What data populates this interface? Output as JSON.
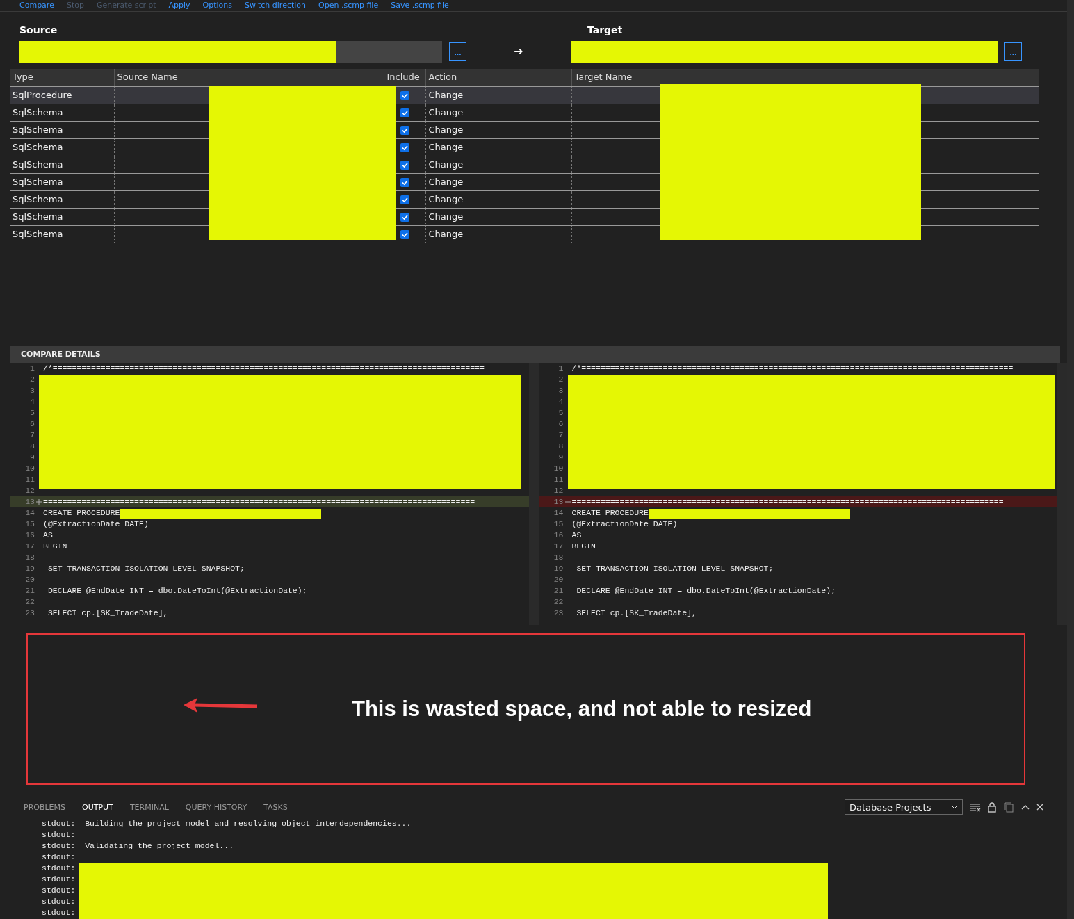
{
  "toolbar": [
    {
      "label": "Compare",
      "disabled": false
    },
    {
      "label": "Stop",
      "disabled": true
    },
    {
      "label": "Generate script",
      "disabled": true
    },
    {
      "label": "Apply",
      "disabled": false
    },
    {
      "label": "Options",
      "disabled": false
    },
    {
      "label": "Switch direction",
      "disabled": false
    },
    {
      "label": "Open .scmp file",
      "disabled": false
    },
    {
      "label": "Save .scmp file",
      "disabled": false
    }
  ],
  "source": {
    "title": "Source",
    "browse": "..."
  },
  "direction_arrow": "➔",
  "target": {
    "title": "Target",
    "browse": "..."
  },
  "table": {
    "columns": [
      "Type",
      "Source Name",
      "Include",
      "Action",
      "Target Name"
    ],
    "rows": [
      {
        "type": "SqlProcedure",
        "include": true,
        "action": "Change",
        "selected": true
      },
      {
        "type": "SqlSchema",
        "include": true,
        "action": "Change",
        "selected": false
      },
      {
        "type": "SqlSchema",
        "include": true,
        "action": "Change",
        "selected": false
      },
      {
        "type": "SqlSchema",
        "include": true,
        "action": "Change",
        "selected": false
      },
      {
        "type": "SqlSchema",
        "include": true,
        "action": "Change",
        "selected": false
      },
      {
        "type": "SqlSchema",
        "include": true,
        "action": "Change",
        "selected": false
      },
      {
        "type": "SqlSchema",
        "include": true,
        "action": "Change",
        "selected": false
      },
      {
        "type": "SqlSchema",
        "include": true,
        "action": "Change",
        "selected": false
      },
      {
        "type": "SqlSchema",
        "include": true,
        "action": "Change",
        "selected": false
      }
    ]
  },
  "compare_details": {
    "title": "COMPARE DETAILS",
    "panes": [
      {
        "lines": [
          {
            "number": "1",
            "kind": "normal",
            "text": "/*=========================================================================================="
          },
          {
            "number": "2",
            "kind": "normal"
          },
          {
            "number": "3",
            "kind": "normal"
          },
          {
            "number": "4",
            "kind": "normal"
          },
          {
            "number": "5",
            "kind": "normal"
          },
          {
            "number": "6",
            "kind": "normal"
          },
          {
            "number": "7",
            "kind": "normal"
          },
          {
            "number": "8",
            "kind": "normal"
          },
          {
            "number": "9",
            "kind": "normal"
          },
          {
            "number": "10",
            "kind": "normal"
          },
          {
            "number": "11",
            "kind": "normal"
          },
          {
            "number": "12",
            "kind": "normal"
          },
          {
            "number": "13",
            "kind": "added",
            "text": "=========================================================================================="
          },
          {
            "number": "14",
            "kind": "normal",
            "text": "CREATE PROCEDURE"
          },
          {
            "number": "15",
            "kind": "normal",
            "text": "(@ExtractionDate DATE)"
          },
          {
            "number": "16",
            "kind": "normal",
            "text": "AS"
          },
          {
            "number": "17",
            "kind": "normal",
            "text": "BEGIN"
          },
          {
            "number": "18",
            "kind": "normal"
          },
          {
            "number": "19",
            "kind": "normal",
            "text": " SET TRANSACTION ISOLATION LEVEL SNAPSHOT;"
          },
          {
            "number": "20",
            "kind": "normal"
          },
          {
            "number": "21",
            "kind": "normal",
            "text": " DECLARE @EndDate INT = dbo.DateToInt(@ExtractionDate);"
          },
          {
            "number": "22",
            "kind": "normal"
          },
          {
            "number": "23",
            "kind": "normal",
            "text": " SELECT cp.[SK_TradeDate],"
          }
        ]
      },
      {
        "lines": [
          {
            "number": "1",
            "kind": "normal",
            "text": "/*=========================================================================================="
          },
          {
            "number": "2",
            "kind": "normal"
          },
          {
            "number": "3",
            "kind": "normal"
          },
          {
            "number": "4",
            "kind": "normal"
          },
          {
            "number": "5",
            "kind": "normal"
          },
          {
            "number": "6",
            "kind": "normal"
          },
          {
            "number": "7",
            "kind": "normal"
          },
          {
            "number": "8",
            "kind": "normal"
          },
          {
            "number": "9",
            "kind": "normal"
          },
          {
            "number": "10",
            "kind": "normal"
          },
          {
            "number": "11",
            "kind": "normal"
          },
          {
            "number": "12",
            "kind": "normal"
          },
          {
            "number": "13",
            "kind": "removed",
            "text": "=========================================================================================="
          },
          {
            "number": "14",
            "kind": "normal",
            "text": "CREATE PROCEDURE"
          },
          {
            "number": "15",
            "kind": "normal",
            "text": "(@ExtractionDate DATE)"
          },
          {
            "number": "16",
            "kind": "normal",
            "text": "AS"
          },
          {
            "number": "17",
            "kind": "normal",
            "text": "BEGIN"
          },
          {
            "number": "18",
            "kind": "normal"
          },
          {
            "number": "19",
            "kind": "normal",
            "text": " SET TRANSACTION ISOLATION LEVEL SNAPSHOT;"
          },
          {
            "number": "20",
            "kind": "normal"
          },
          {
            "number": "21",
            "kind": "normal",
            "text": " DECLARE @EndDate INT = dbo.DateToInt(@ExtractionDate);"
          },
          {
            "number": "22",
            "kind": "normal"
          },
          {
            "number": "23",
            "kind": "normal",
            "text": " SELECT cp.[SK_TradeDate],"
          }
        ]
      }
    ]
  },
  "annotation": {
    "text": "This is wasted space, and not able to resized"
  },
  "panel": {
    "tabs": [
      {
        "label": "PROBLEMS",
        "selected": false
      },
      {
        "label": "OUTPUT",
        "selected": true
      },
      {
        "label": "TERMINAL",
        "selected": false
      },
      {
        "label": "QUERY HISTORY",
        "selected": false
      },
      {
        "label": "TASKS",
        "selected": false
      }
    ],
    "channel": "Database Projects",
    "output": [
      {
        "prefix": "stdout:",
        "text": "Building the project model and resolving object interdependencies..."
      },
      {
        "prefix": "stdout:"
      },
      {
        "prefix": "stdout:",
        "text": "Validating the project model..."
      },
      {
        "prefix": "stdout:"
      },
      {
        "prefix": "stdout:"
      },
      {
        "prefix": "stdout:"
      },
      {
        "prefix": "stdout:"
      },
      {
        "prefix": "stdout:"
      },
      {
        "prefix": "stdout:"
      }
    ]
  }
}
